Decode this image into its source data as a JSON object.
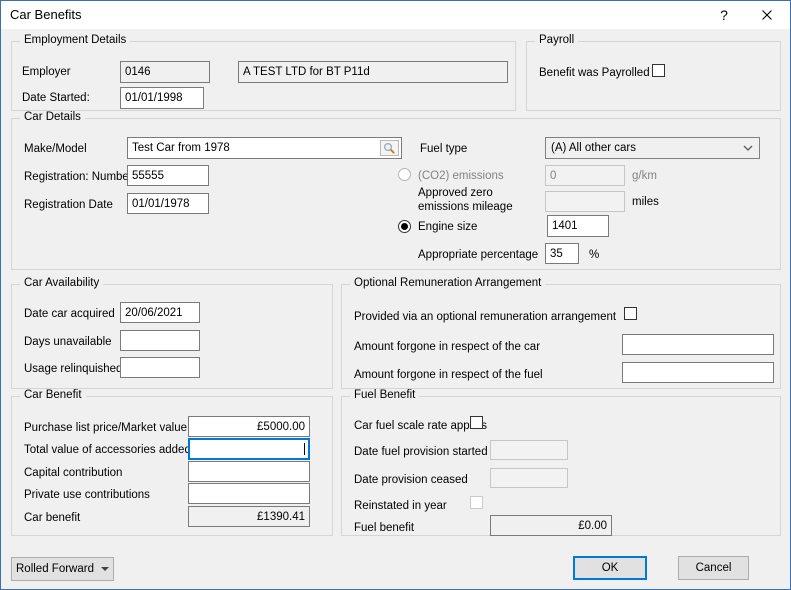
{
  "window": {
    "title": "Car Benefits",
    "help_glyph": "?"
  },
  "employment_details": {
    "title": "Employment Details",
    "employer_label": "Employer",
    "employer_code": "0146",
    "employer_name": "A TEST LTD for BT P11d",
    "date_started_label": "Date Started:",
    "date_started": "01/01/1998"
  },
  "payroll": {
    "title": "Payroll",
    "benefit_was_payrolled_label": "Benefit was Payrolled",
    "benefit_was_payrolled_checked": false
  },
  "car_details": {
    "title": "Car Details",
    "make_model_label": "Make/Model",
    "make_model": "Test Car from 1978",
    "fuel_type_label": "Fuel type",
    "fuel_type": "(A) All other cars",
    "registration_number_label": "Registration: Number",
    "registration_number": "55555",
    "co2_emissions_label": "(CO2) emissions",
    "co2_emissions": "0",
    "co2_unit": "g/km",
    "co2_selected": false,
    "registration_date_label": "Registration Date",
    "registration_date": "01/01/1978",
    "approved_zero_line1": "Approved zero",
    "approved_zero_line2": "emissions mileage",
    "approved_zero_mileage": "",
    "mileage_unit": "miles",
    "engine_size_label": "Engine size",
    "engine_size": "1401",
    "engine_selected": true,
    "appropriate_percentage_label": "Appropriate percentage",
    "appropriate_percentage": "35",
    "percent_unit": "%"
  },
  "car_availability": {
    "title": "Car Availability",
    "date_car_acquired_label": "Date car acquired",
    "date_car_acquired": "20/06/2021",
    "days_unavailable_label": "Days unavailable",
    "days_unavailable": "",
    "usage_relinquished_label": "Usage relinquished",
    "usage_relinquished": ""
  },
  "optional_remuneration": {
    "title": "Optional Remuneration Arrangement",
    "provided_label": "Provided via an optional remuneration arrangement",
    "provided_checked": false,
    "amount_car_label": "Amount forgone in respect of the car",
    "amount_car": "",
    "amount_fuel_label": "Amount forgone in respect of the fuel",
    "amount_fuel": ""
  },
  "car_benefit": {
    "title": "Car Benefit",
    "purchase_price_label": "Purchase list price/Market value",
    "purchase_price": "£5000.00",
    "accessories_label": "Total value of accessories added",
    "accessories_value": "",
    "capital_contribution_label": "Capital contribution",
    "capital_contribution": "",
    "private_use_label": "Private use contributions",
    "private_use": "",
    "car_benefit_label": "Car benefit",
    "car_benefit_value": "£1390.41"
  },
  "fuel_benefit": {
    "title": "Fuel Benefit",
    "scale_rate_label": "Car fuel scale rate applies",
    "scale_rate_checked": false,
    "date_fuel_started_label": "Date fuel provision started",
    "date_fuel_started": "",
    "date_ceased_label": "Date provision ceased",
    "date_ceased": "",
    "reinstated_label": "Reinstated in year",
    "reinstated_checked": false,
    "fuel_benefit_label": "Fuel benefit",
    "fuel_benefit_value": "£0.00"
  },
  "footer": {
    "rolled_forward_label": "Rolled Forward",
    "ok_label": "OK",
    "cancel_label": "Cancel"
  },
  "colors": {
    "accent": "#0078d7",
    "dialog_bg": "#f0f0f0",
    "titlebar_bg": "#ffffff",
    "field_border": "#7a7a7a",
    "readonly_bg": "#f0f0f0",
    "disabled_text": "#838383",
    "button_bg": "#e1e1e1",
    "window_border": "#3c6eb4"
  }
}
